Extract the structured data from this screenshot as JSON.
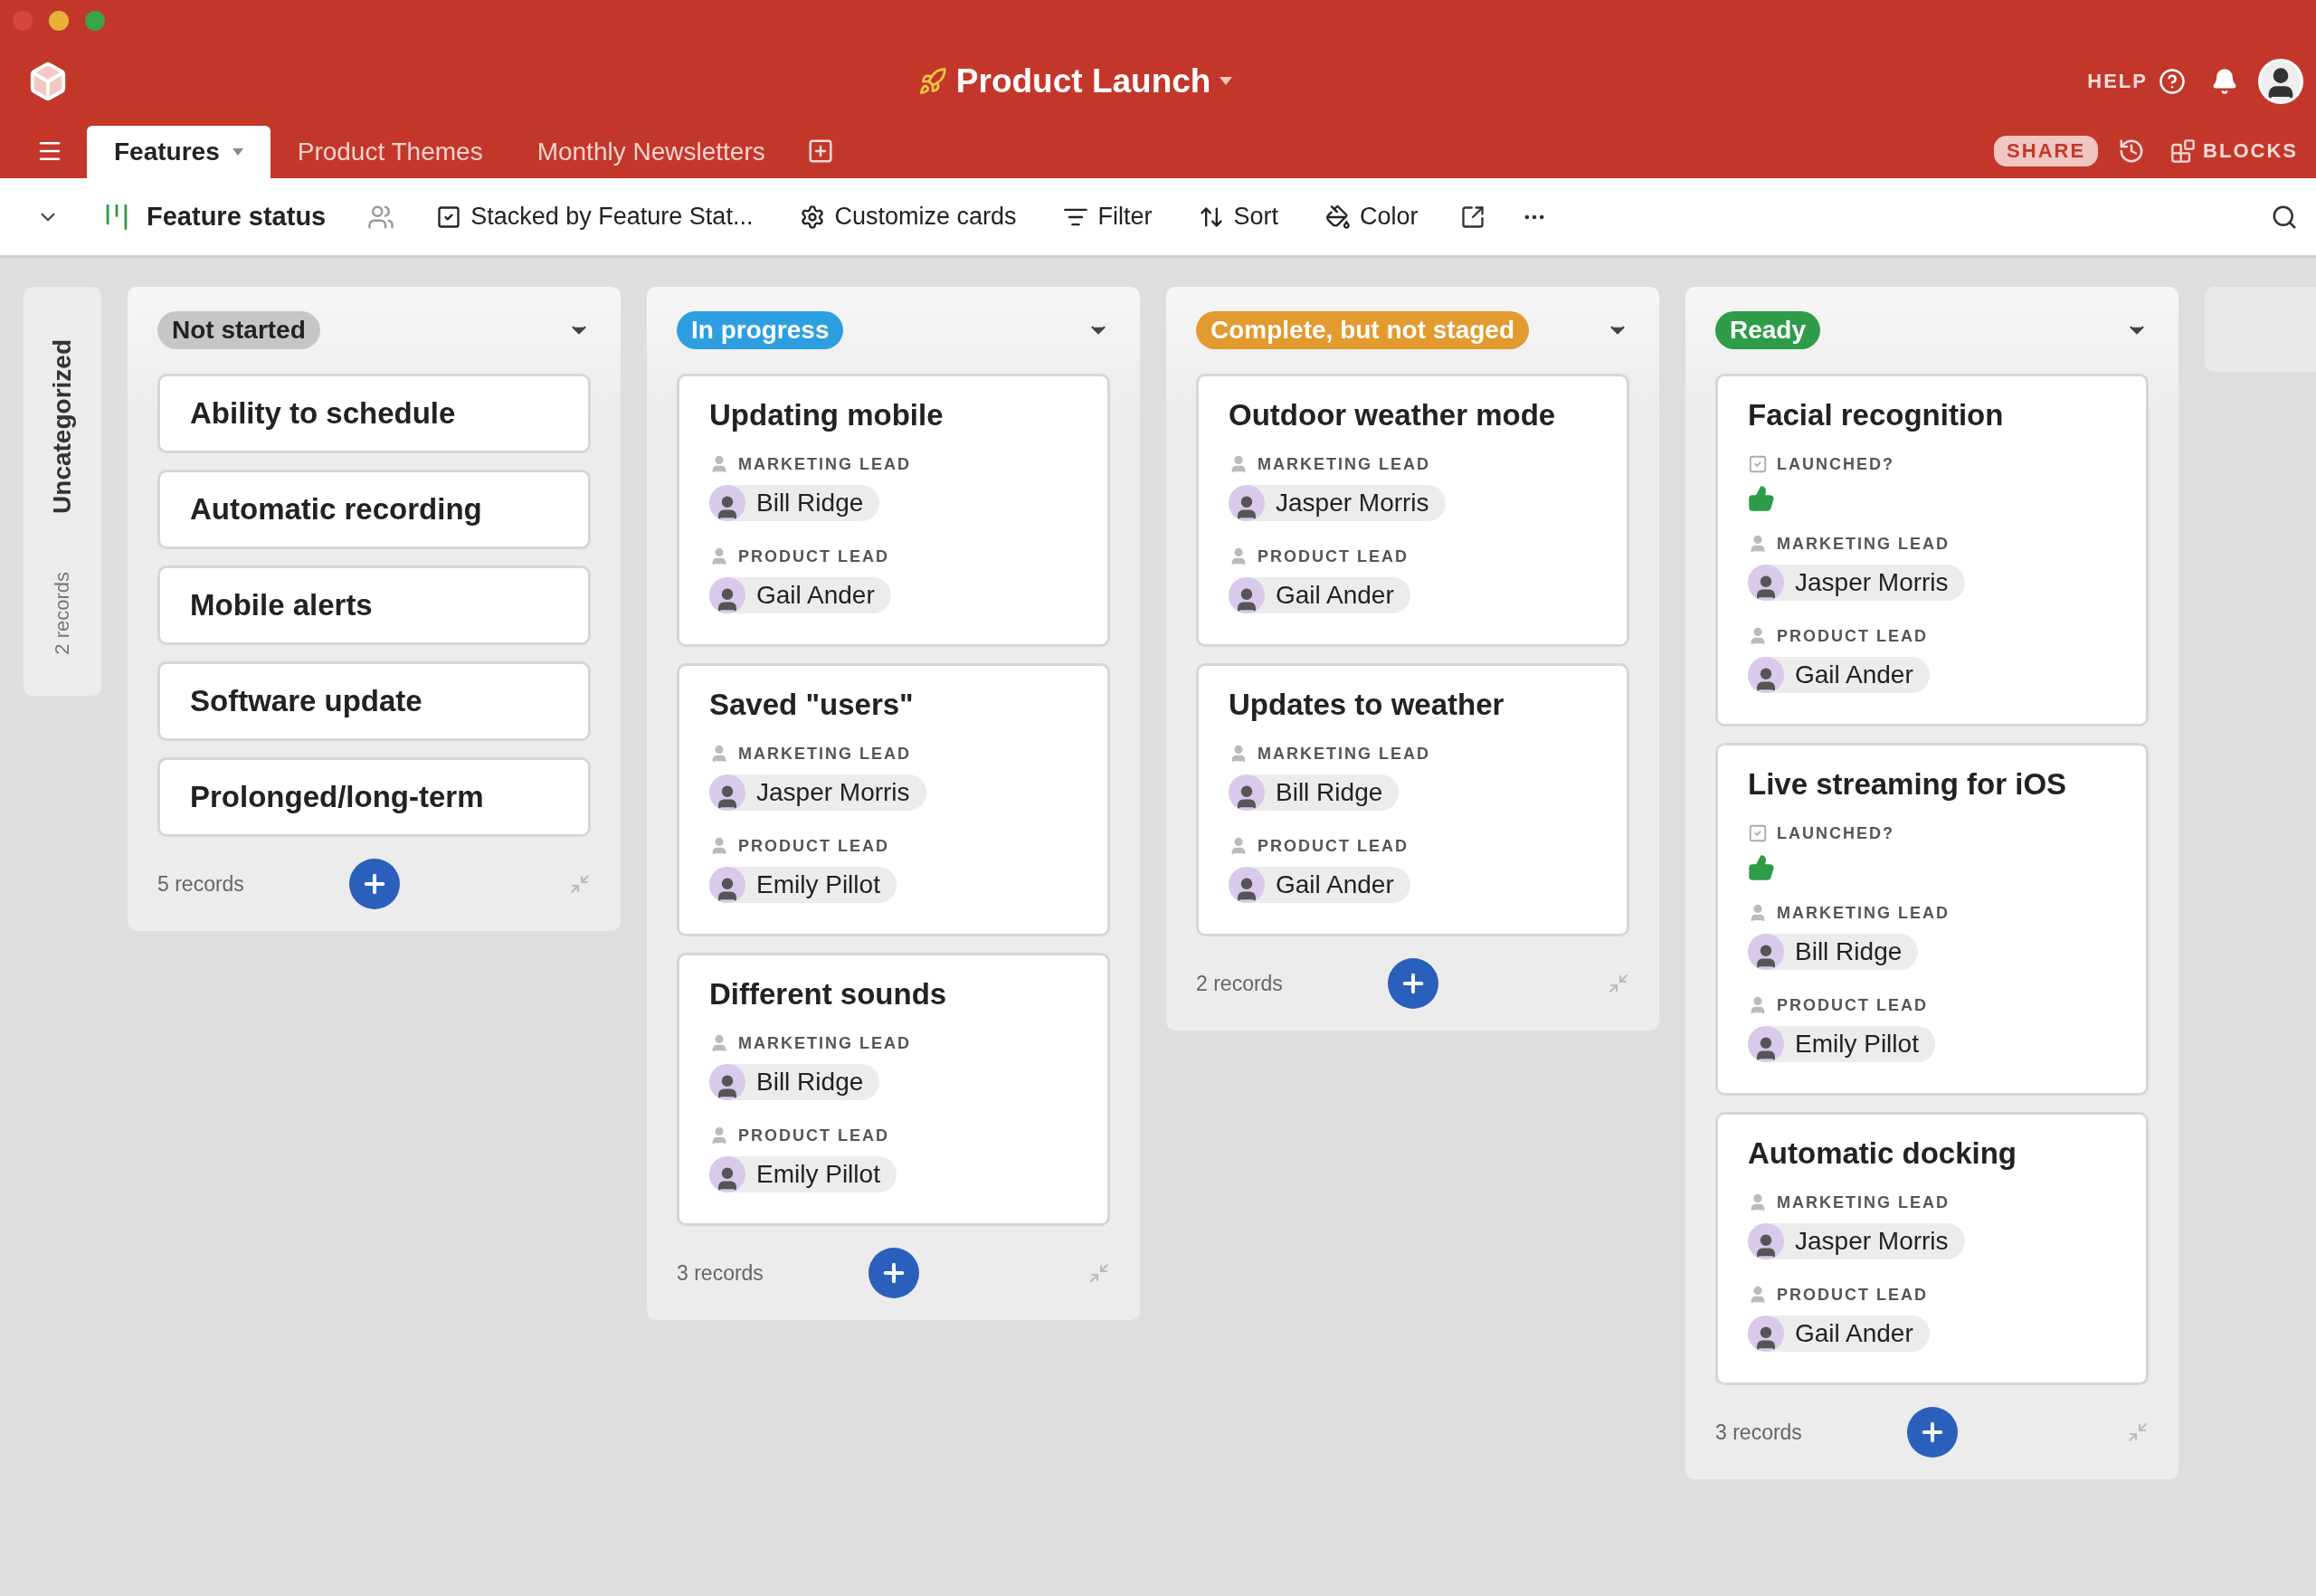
{
  "base": {
    "title": "Product Launch",
    "help": "HELP"
  },
  "tables": [
    {
      "label": "Features",
      "selected": true
    },
    {
      "label": "Product Themes",
      "selected": false
    },
    {
      "label": "Monthly Newsletters",
      "selected": false
    }
  ],
  "share": "SHARE",
  "blocks": "BLOCKS",
  "view": {
    "name": "Feature status"
  },
  "toolbar": [
    {
      "kind": "stack",
      "label": "Stacked by Feature Stat..."
    },
    {
      "kind": "customize",
      "label": "Customize cards"
    },
    {
      "kind": "filter",
      "label": "Filter"
    },
    {
      "kind": "sort",
      "label": "Sort"
    },
    {
      "kind": "color",
      "label": "Color"
    }
  ],
  "uncategorized": {
    "title": "Uncategorized",
    "count": "2 records"
  },
  "columns": [
    {
      "status": "Not started",
      "color": "#c6c6c6",
      "footer": "5 records",
      "cards": [
        {
          "title": "Ability to schedule"
        },
        {
          "title": "Automatic recording"
        },
        {
          "title": "Mobile alerts"
        },
        {
          "title": "Software update"
        },
        {
          "title": "Prolonged/long-term"
        }
      ]
    },
    {
      "status": "In progress",
      "color": "#2d9fe0",
      "footer": "3 records",
      "cards": [
        {
          "title": "Updating mobile",
          "fields": [
            {
              "kind": "user",
              "label": "MARKETING LEAD",
              "user": "Bill Ridge"
            },
            {
              "kind": "user",
              "label": "PRODUCT LEAD",
              "user": "Gail Ander"
            }
          ]
        },
        {
          "title": "Saved \"users\"",
          "fields": [
            {
              "kind": "user",
              "label": "MARKETING LEAD",
              "user": "Jasper Morris"
            },
            {
              "kind": "user",
              "label": "PRODUCT LEAD",
              "user": "Emily Pillot"
            }
          ]
        },
        {
          "title": "Different sounds",
          "fields": [
            {
              "kind": "user",
              "label": "MARKETING LEAD",
              "user": "Bill Ridge"
            },
            {
              "kind": "user",
              "label": "PRODUCT LEAD",
              "user": "Emily Pillot"
            }
          ]
        }
      ]
    },
    {
      "status": "Complete, but not staged",
      "color": "#e39a2f",
      "footer": "2 records",
      "cards": [
        {
          "title": "Outdoor weather mode",
          "fields": [
            {
              "kind": "user",
              "label": "MARKETING LEAD",
              "user": "Jasper Morris"
            },
            {
              "kind": "user",
              "label": "PRODUCT LEAD",
              "user": "Gail Ander"
            }
          ]
        },
        {
          "title": "Updates to weather",
          "fields": [
            {
              "kind": "user",
              "label": "MARKETING LEAD",
              "user": "Bill Ridge"
            },
            {
              "kind": "user",
              "label": "PRODUCT LEAD",
              "user": "Gail Ander"
            }
          ]
        }
      ]
    },
    {
      "status": "Ready",
      "color": "#2e9c48",
      "footer": "3 records",
      "cards": [
        {
          "title": "Facial recognition",
          "fields": [
            {
              "kind": "checkbox",
              "label": "LAUNCHED?",
              "checked": true
            },
            {
              "kind": "user",
              "label": "MARKETING LEAD",
              "user": "Jasper Morris"
            },
            {
              "kind": "user",
              "label": "PRODUCT LEAD",
              "user": "Gail Ander"
            }
          ]
        },
        {
          "title": "Live streaming for iOS",
          "fields": [
            {
              "kind": "checkbox",
              "label": "LAUNCHED?",
              "checked": true
            },
            {
              "kind": "user",
              "label": "MARKETING LEAD",
              "user": "Bill Ridge"
            },
            {
              "kind": "user",
              "label": "PRODUCT LEAD",
              "user": "Emily Pillot"
            }
          ]
        },
        {
          "title": "Automatic docking",
          "fields": [
            {
              "kind": "user",
              "label": "MARKETING LEAD",
              "user": "Jasper Morris"
            },
            {
              "kind": "user",
              "label": "PRODUCT LEAD",
              "user": "Gail Ander"
            }
          ]
        }
      ]
    }
  ]
}
